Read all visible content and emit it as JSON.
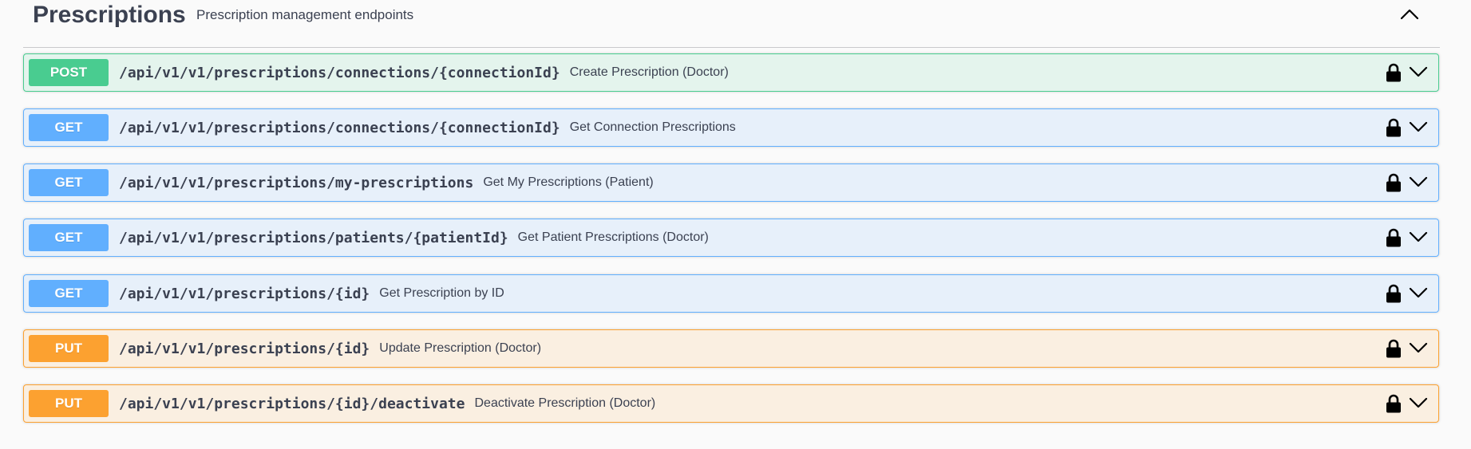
{
  "tag": {
    "title": "Prescriptions",
    "description": "Prescription management endpoints",
    "collapse_icon": "chevron-up-icon"
  },
  "colors": {
    "post": "#49cc90",
    "get": "#61affe",
    "put": "#fca130",
    "text": "#3b4151"
  },
  "operations": [
    {
      "method": "POST",
      "path": "/api/v1/v1/prescriptions/connections/{connectionId}",
      "summary": "Create Prescription (Doctor)",
      "locked": true
    },
    {
      "method": "GET",
      "path": "/api/v1/v1/prescriptions/connections/{connectionId}",
      "summary": "Get Connection Prescriptions",
      "locked": true
    },
    {
      "method": "GET",
      "path": "/api/v1/v1/prescriptions/my-prescriptions",
      "summary": "Get My Prescriptions (Patient)",
      "locked": true
    },
    {
      "method": "GET",
      "path": "/api/v1/v1/prescriptions/patients/{patientId}",
      "summary": "Get Patient Prescriptions (Doctor)",
      "locked": true
    },
    {
      "method": "GET",
      "path": "/api/v1/v1/prescriptions/{id}",
      "summary": "Get Prescription by ID",
      "locked": true
    },
    {
      "method": "PUT",
      "path": "/api/v1/v1/prescriptions/{id}",
      "summary": "Update Prescription (Doctor)",
      "locked": true
    },
    {
      "method": "PUT",
      "path": "/api/v1/v1/prescriptions/{id}/deactivate",
      "summary": "Deactivate Prescription (Doctor)",
      "locked": true
    }
  ]
}
